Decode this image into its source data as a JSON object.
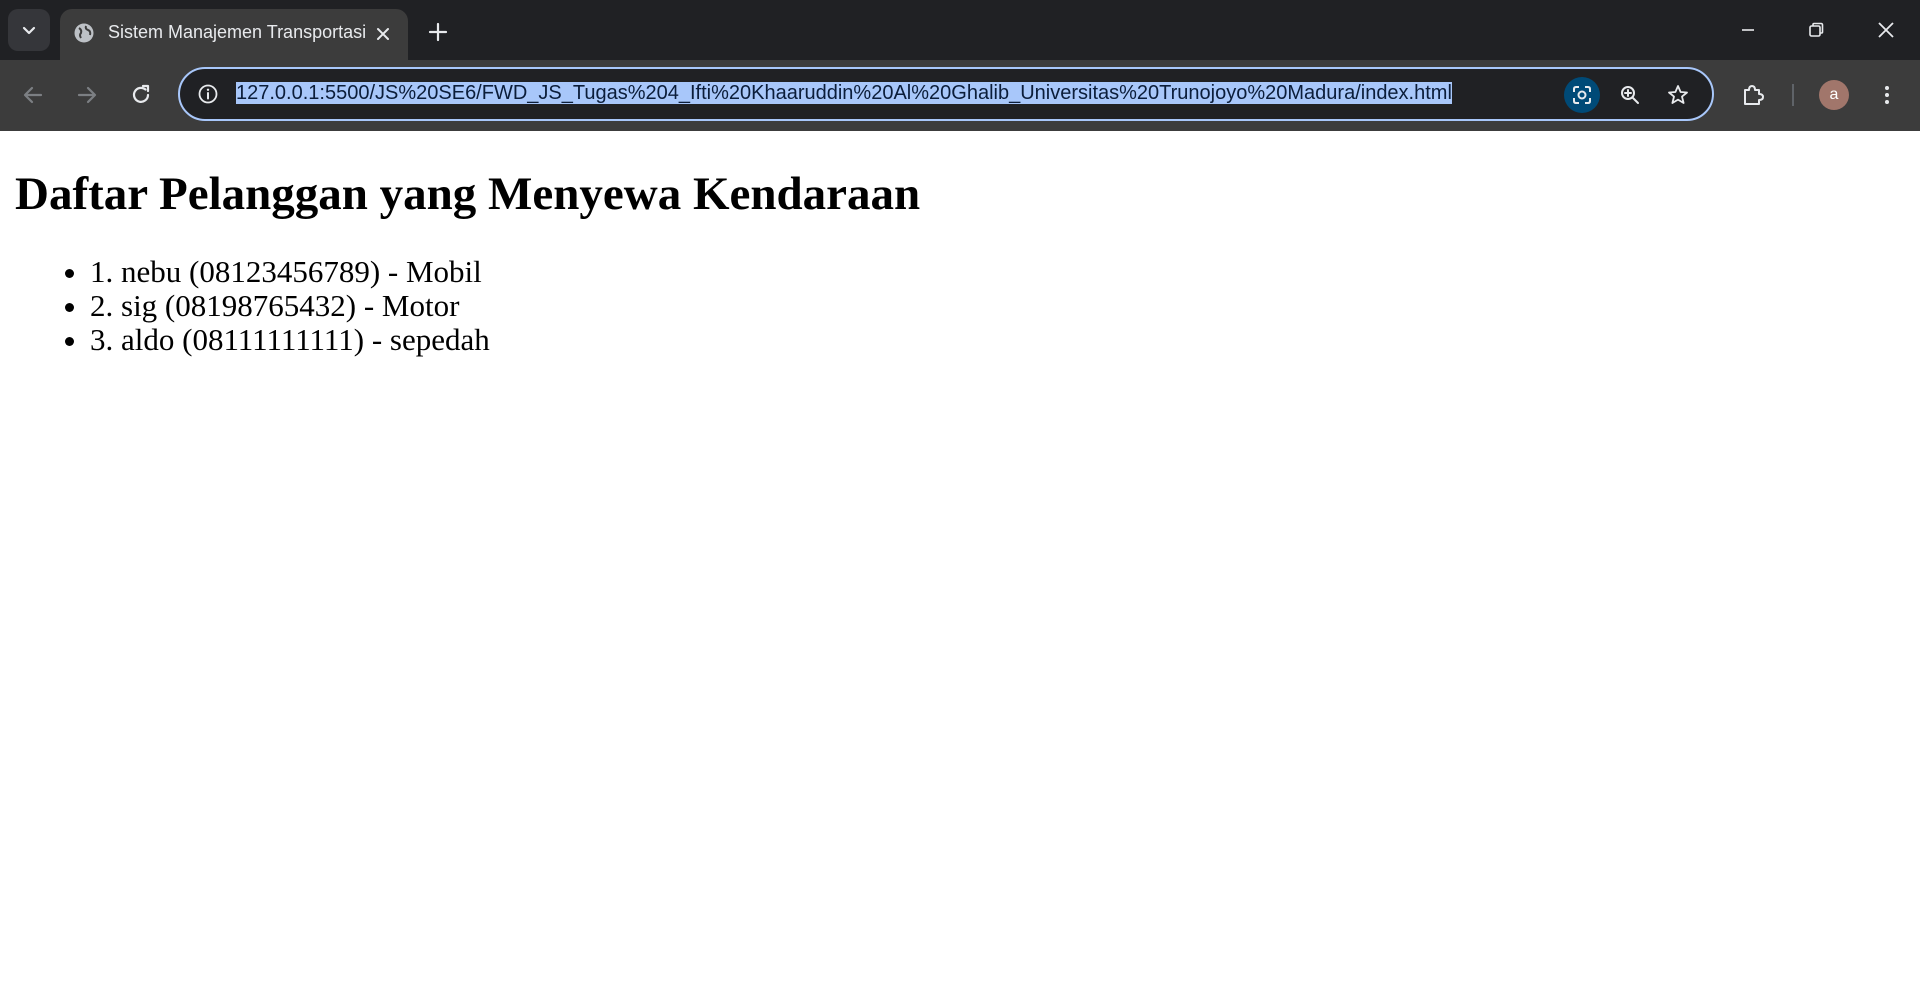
{
  "browser": {
    "tab_title": "Sistem Manajemen Transportasi",
    "url": "127.0.0.1:5500/JS%20SE6/FWD_JS_Tugas%204_Ifti%20Khaaruddin%20Al%20Ghalib_Universitas%20Trunojoyo%20Madura/index.html",
    "profile_initial": "a",
    "icons": {
      "tab_search": "chevron-down-icon",
      "favicon": "globe-icon",
      "tab_close": "close-icon",
      "new_tab": "plus-icon",
      "minimize": "minimize-icon",
      "restore": "restore-icon",
      "close_window": "close-icon",
      "back": "arrow-left-icon",
      "forward": "arrow-right-icon",
      "reload": "reload-icon",
      "site_info": "info-icon",
      "lens": "google-lens-icon",
      "zoom": "zoom-icon",
      "bookmark": "star-icon",
      "extensions": "puzzle-icon",
      "menu": "kebab-menu-icon"
    },
    "colors": {
      "tabstrip_bg": "#202124",
      "toolbar_bg": "#3c3c3c",
      "omnibox_border": "#a8c7fa",
      "url_selection": "#a8c7fa",
      "avatar_bg": "#a1766b"
    }
  },
  "page": {
    "heading": "Daftar Pelanggan yang Menyewa Kendaraan",
    "customers": [
      {
        "text": "1. nebu (08123456789) - Mobil"
      },
      {
        "text": "2. sig (08198765432) - Motor"
      },
      {
        "text": "3. aldo (08111111111) - sepedah"
      }
    ]
  }
}
